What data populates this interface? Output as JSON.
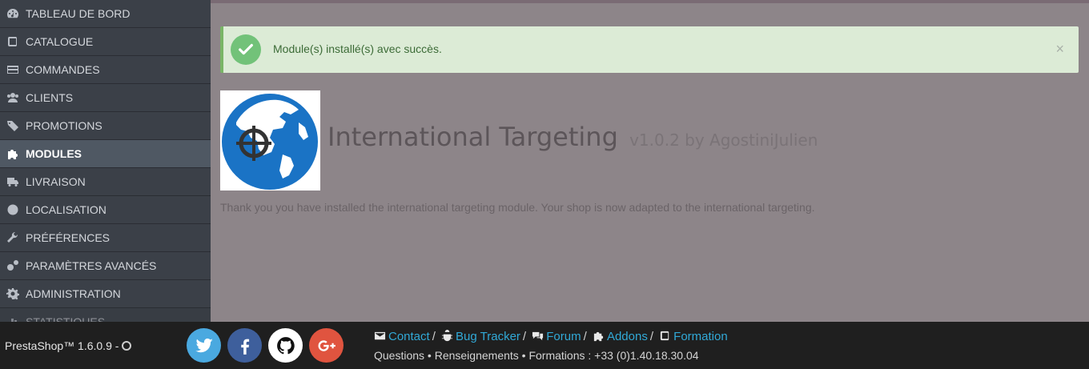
{
  "sidebar": {
    "items": [
      {
        "label": "TABLEAU DE BORD",
        "icon": "dashboard-icon"
      },
      {
        "label": "CATALOGUE",
        "icon": "book-icon"
      },
      {
        "label": "COMMANDES",
        "icon": "credit-card-icon"
      },
      {
        "label": "CLIENTS",
        "icon": "users-icon"
      },
      {
        "label": "PROMOTIONS",
        "icon": "tags-icon"
      },
      {
        "label": "MODULES",
        "icon": "puzzle-icon",
        "active": true
      },
      {
        "label": "LIVRAISON",
        "icon": "truck-icon"
      },
      {
        "label": "LOCALISATION",
        "icon": "globe-icon"
      },
      {
        "label": "PRÉFÉRENCES",
        "icon": "wrench-icon"
      },
      {
        "label": "PARAMÈTRES AVANCÉS",
        "icon": "cogs-icon"
      },
      {
        "label": "ADMINISTRATION",
        "icon": "cog-icon"
      },
      {
        "label": "STATISTIQUES",
        "icon": "bar-chart-icon"
      }
    ]
  },
  "alert": {
    "message": "Module(s) installé(s) avec succès.",
    "close": "×",
    "color": "#dcebd6"
  },
  "module": {
    "name": "International Targeting",
    "version_author": "v1.0.2 by AgostiniJulien",
    "description": "Thank you you have installed the international targeting module. Your shop is now adapted to the international targeting."
  },
  "footer": {
    "version": "PrestaShop™ 1.6.0.9 -",
    "links": [
      {
        "label": "Contact",
        "icon": "envelope-icon"
      },
      {
        "label": "Bug Tracker",
        "icon": "bug-icon"
      },
      {
        "label": "Forum",
        "icon": "comments-icon"
      },
      {
        "label": "Addons",
        "icon": "puzzle-icon"
      },
      {
        "label": "Formation",
        "icon": "book-icon"
      }
    ],
    "separator": "/",
    "contact_line": "Questions • Renseignements • Formations : +33 (0)1.40.18.30.04",
    "social": [
      {
        "name": "twitter",
        "color": "#4aa9e0"
      },
      {
        "name": "facebook",
        "color": "#3e5f9c"
      },
      {
        "name": "github",
        "color": "#ffffff"
      },
      {
        "name": "google-plus",
        "color": "#e0543f"
      }
    ]
  }
}
